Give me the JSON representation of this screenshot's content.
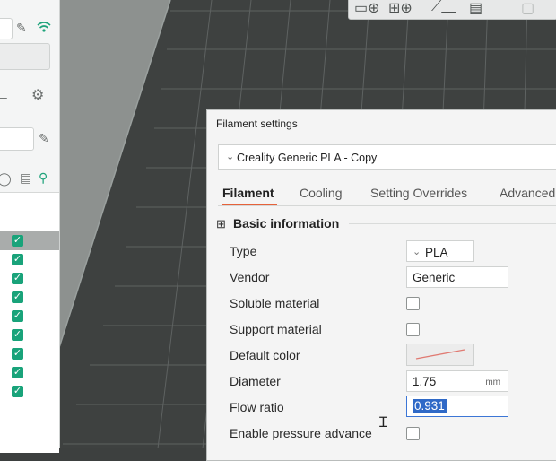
{
  "dialog": {
    "title": "Filament settings",
    "preset": "Creality Generic PLA - Copy",
    "tabs": [
      "Filament",
      "Cooling",
      "Setting Overrides",
      "Advanced"
    ],
    "active_tab": "Filament",
    "section_title": "Basic information",
    "fields": {
      "type": {
        "label": "Type",
        "value": "PLA"
      },
      "vendor": {
        "label": "Vendor",
        "value": "Generic"
      },
      "soluble": {
        "label": "Soluble material",
        "checked": false
      },
      "support": {
        "label": "Support material",
        "checked": false
      },
      "default_color": {
        "label": "Default color"
      },
      "diameter": {
        "label": "Diameter",
        "value": "1.75",
        "unit": "mm"
      },
      "flow_ratio": {
        "label": "Flow ratio",
        "value": "0.931"
      },
      "pressure_advance": {
        "label": "Enable pressure advance",
        "checked": false
      }
    }
  },
  "left_panel": {
    "checked_rows": 9,
    "selected_row": 0
  },
  "colors": {
    "accent": "#e6623a",
    "check": "#19a37a",
    "selection": "#2f69c7",
    "bed": "#3d403f"
  },
  "icons": [
    "edit-icon",
    "wifi-icon",
    "gear-icon",
    "refresh-icon",
    "list-icon",
    "connect-icon",
    "add-plate-icon",
    "grid-icon",
    "orient-icon",
    "arrange-icon",
    "split-icon",
    "basic-info-icon"
  ]
}
